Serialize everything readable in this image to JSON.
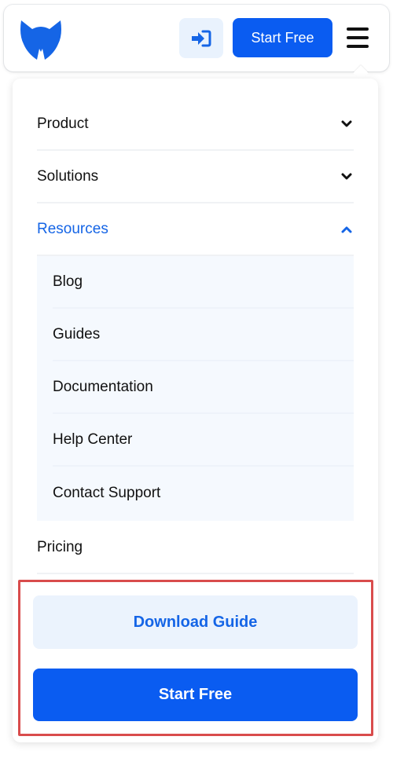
{
  "header": {
    "logo_icon": "fox-logo-icon",
    "login_icon": "sign-in-icon",
    "start_free_label": "Start Free",
    "menu_icon": "hamburger-menu-icon"
  },
  "menu": {
    "items": [
      {
        "label": "Product",
        "state": "collapsed"
      },
      {
        "label": "Solutions",
        "state": "collapsed"
      },
      {
        "label": "Resources",
        "state": "expanded"
      },
      {
        "label": "Pricing"
      }
    ],
    "resources_submenu": [
      {
        "label": "Blog"
      },
      {
        "label": "Guides"
      },
      {
        "label": "Documentation"
      },
      {
        "label": "Help Center"
      },
      {
        "label": "Contact Support"
      }
    ]
  },
  "cta": {
    "download_label": "Download Guide",
    "start_free_label": "Start Free"
  },
  "colors": {
    "primary": "#0a5cf1",
    "accent_text": "#1565e6",
    "light_blue_bg": "#ebf3fd",
    "highlight_border": "#d94c4c"
  }
}
